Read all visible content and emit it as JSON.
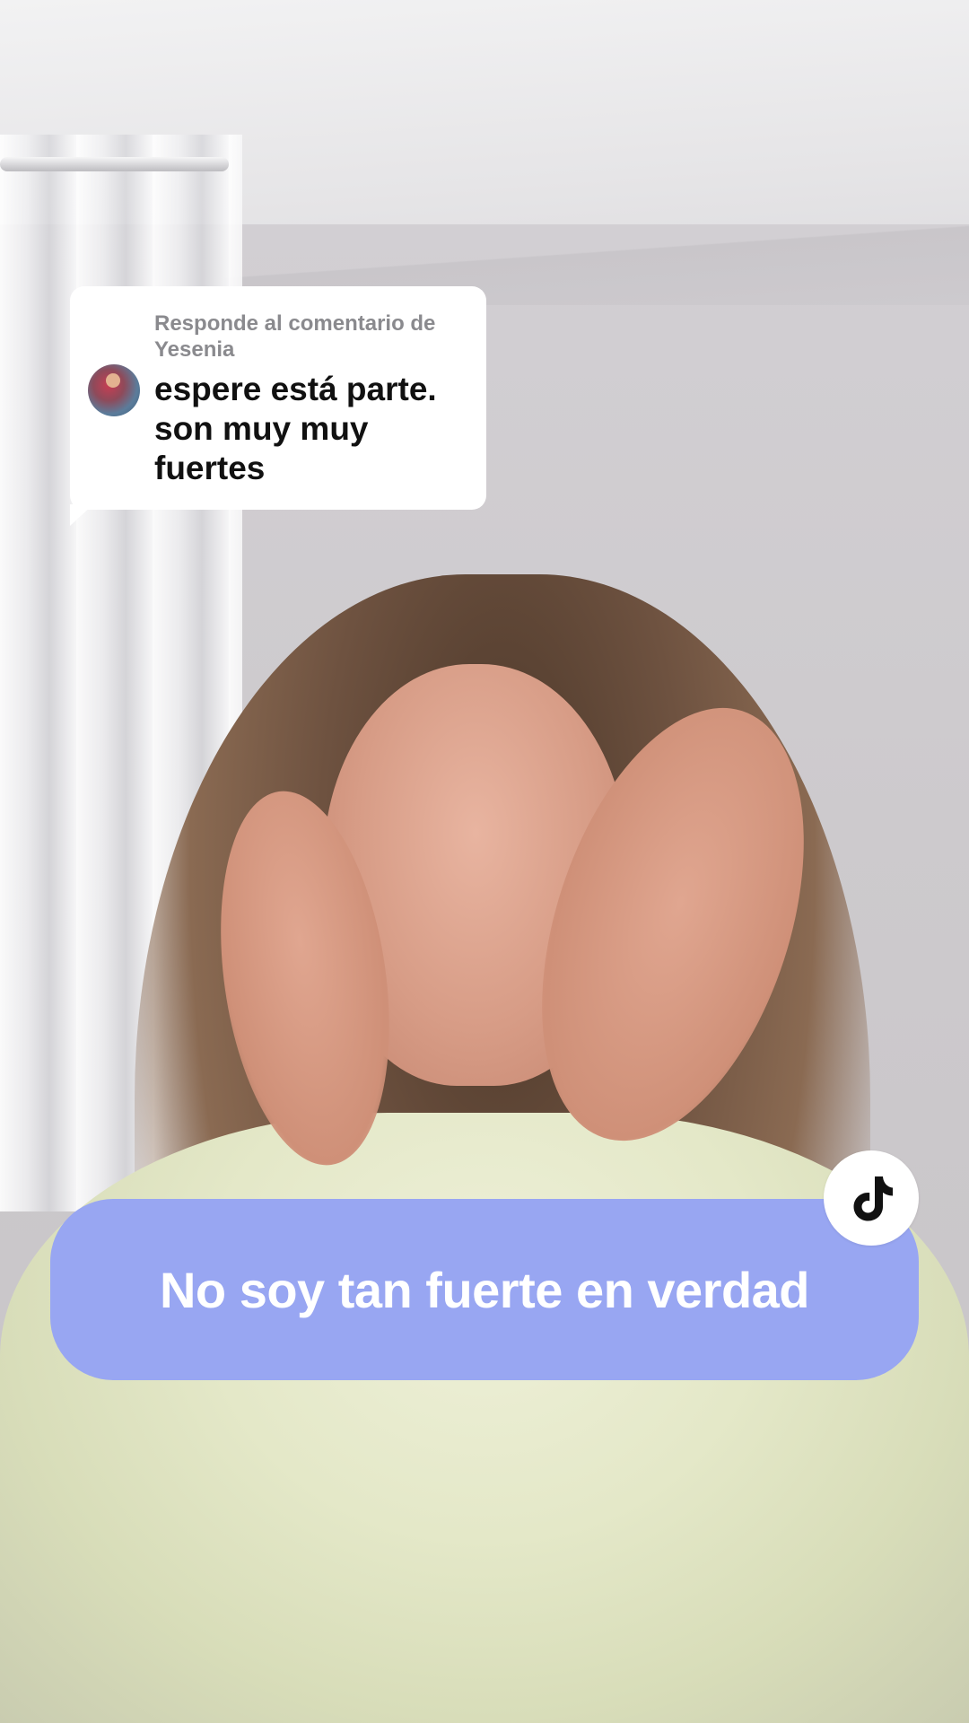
{
  "reply_card": {
    "header": "Responde al comentario de Yesenia",
    "comment": "espere está parte. son muy muy fuertes"
  },
  "caption": {
    "text": "No soy tan fuerte en verdad",
    "background_color": "#98a6f2",
    "text_color": "#ffffff"
  },
  "badge": {
    "icon": "tiktok-logo-icon"
  }
}
